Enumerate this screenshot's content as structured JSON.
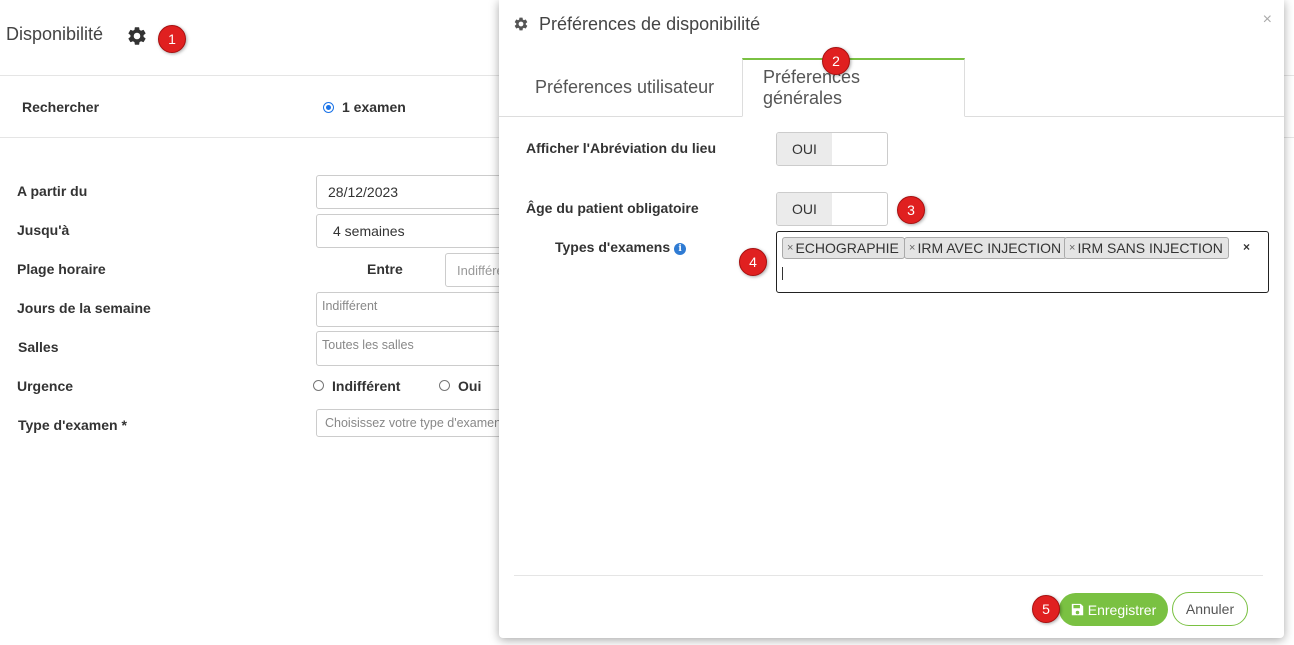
{
  "page": {
    "title": "Disponibilité",
    "search_label": "Rechercher",
    "search_option": "1 examen",
    "form": {
      "from_label": "A partir du",
      "from_value": "28/12/2023",
      "until_label": "Jusqu'à",
      "until_value": "4 semaines",
      "time_range_label": "Plage horaire",
      "between_label": "Entre",
      "time_placeholder": "Indifféren",
      "weekdays_label": "Jours de la semaine",
      "weekdays_placeholder": "Indifférent",
      "rooms_label": "Salles",
      "rooms_placeholder": "Toutes les salles",
      "urgency_label": "Urgence",
      "urgency_options": [
        "Indifférent",
        "Oui"
      ],
      "exam_type_label": "Type d'examen *",
      "exam_type_placeholder": "Choisissez votre type d'examen"
    }
  },
  "modal": {
    "title": "Préférences de disponibilité",
    "close": "×",
    "tabs": [
      "Préferences utilisateur",
      "Préferences générales"
    ],
    "active_tab": 1,
    "rows": {
      "abbrev_label": "Afficher l'Abréviation du lieu",
      "abbrev_value": "OUI",
      "age_label": "Âge du patient obligatoire",
      "age_value": "OUI",
      "exam_types_label": "Types d'examens",
      "exam_types_tags": [
        "ECHOGRAPHIE",
        "IRM AVEC INJECTION",
        "IRM SANS INJECTION"
      ],
      "tag_remove": "×",
      "clear_all": "×"
    },
    "footer": {
      "save_label": "Enregistrer",
      "cancel_label": "Annuler"
    }
  },
  "markers": [
    "1",
    "2",
    "3",
    "4",
    "5"
  ],
  "colors": {
    "accent_green": "#7ac142",
    "marker_red": "#e02020",
    "radio_blue": "#1a73e8",
    "info_blue": "#2f7bd3"
  },
  "icons": [
    "gear-icon",
    "info-icon",
    "save-icon",
    "close-icon"
  ]
}
